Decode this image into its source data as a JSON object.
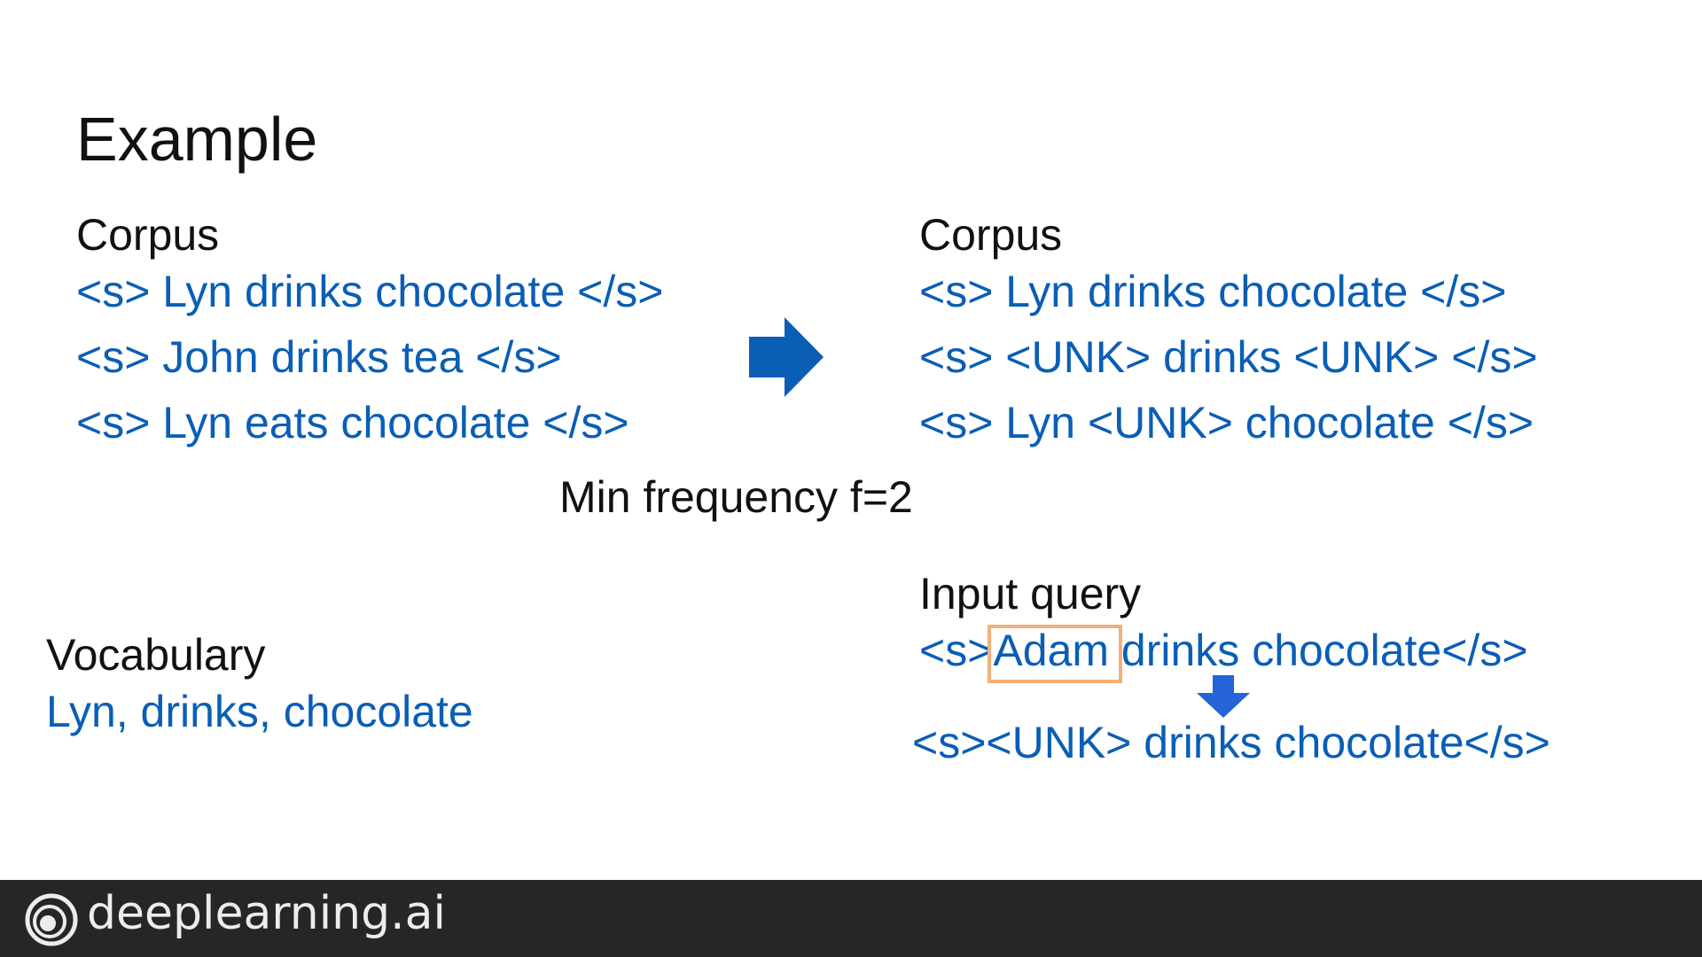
{
  "slide": {
    "title": "Example",
    "left_corpus": {
      "heading": "Corpus",
      "lines": [
        "<s> Lyn drinks chocolate </s>",
        "<s> John drinks tea </s>",
        "<s> Lyn eats chocolate </s>"
      ]
    },
    "right_corpus": {
      "heading": "Corpus",
      "lines": [
        "<s> Lyn drinks chocolate </s>",
        "<s> <UNK> drinks <UNK> </s>",
        "<s> Lyn <UNK> chocolate </s>"
      ]
    },
    "min_frequency": "Min frequency f=2",
    "vocabulary": {
      "heading": "Vocabulary",
      "words": "Lyn, drinks, chocolate"
    },
    "input_query": {
      "heading": "Input query",
      "prefix": "<s>",
      "highlighted_word": "Adam",
      "suffix": " drinks chocolate</s>",
      "result": "<s><UNK> drinks chocolate</s>"
    },
    "colors": {
      "text": "#111111",
      "accent_blue": "#0a5eb6",
      "arrow_blue": "#0a5eb6",
      "small_arrow_blue": "#2563d9",
      "highlight_box": "#f2b07a",
      "footer_bg": "#262626"
    }
  },
  "footer": {
    "brand": "deeplearning.ai",
    "logo_icon": "deeplearning-logo-icon"
  }
}
